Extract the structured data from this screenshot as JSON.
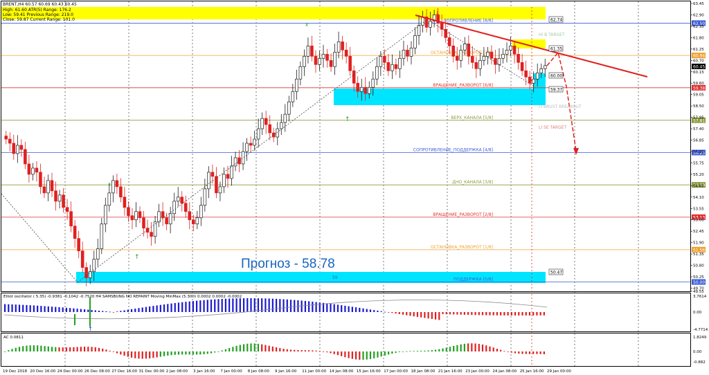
{
  "header": {
    "symbol_line": "BRENT,H4  60.57 60.69 60.43 60.45",
    "stats": [
      "High: 61.60   ATR(5) Range: 176.2",
      "Low:   59.41   Previous Range: 219.0",
      "Close: 59.87   Current Range: 101.0"
    ]
  },
  "forecast_text": "Прогноз - 58.78",
  "murrey_levels": [
    {
      "price": 62.5,
      "label": "СОПРОТИВЛЕНИЕ [8/8]",
      "color": "#3b5bd6",
      "tag": "62.50"
    },
    {
      "price": 60.94,
      "label": "ОСТАНОВКА_РАЗВОРОТ [7/8]",
      "color": "#f0a030",
      "tag": "60.94"
    },
    {
      "price": 59.38,
      "label": "ВРАЩЕНИЕ_РАЗВОРОТ [6/8]",
      "color": "#e03030",
      "tag": "59.38"
    },
    {
      "price": 57.81,
      "label": "ВЕРХ_КАНАЛА [5/8]",
      "color": "#8a9a3a",
      "tag": "57.81"
    },
    {
      "price": 56.25,
      "label": "СОПРОТИВЛЕНИЕ_ПОДДЕРЖКА [4/8]",
      "color": "#3b5bd6",
      "tag": "56.25"
    },
    {
      "price": 54.69,
      "label": "ДНО_КАНАЛА [3/8]",
      "color": "#8a9a3a",
      "tag": "54.69"
    },
    {
      "price": 53.13,
      "label": "ВРАЩЕНИЕ_РАЗВОРОТ [2/8]",
      "color": "#e03030",
      "tag": "53.13"
    },
    {
      "price": 51.56,
      "label": "ОСТАНОВКА_РАЗВОРОТ [1/8]",
      "color": "#f0a030",
      "tag": "51.56"
    },
    {
      "price": 50.0,
      "label": "ПОДДЕРЖКА [0/8]",
      "color": "#3b5bd6",
      "tag": "50.00"
    }
  ],
  "box_tags": [
    "62.74",
    "61.35",
    "60.00",
    "59.37",
    "50.47"
  ],
  "target_labels": [
    "Hi B TARGET",
    "LI BRUST BREAKOUT",
    "LI SE TARGET"
  ],
  "zone_label": "59",
  "price_axis": [
    "63.45",
    "62.90",
    "62.35",
    "61.80",
    "61.25",
    "60.70",
    "60.15",
    "59.60",
    "59.05",
    "58.50",
    "57.95",
    "57.40",
    "56.85",
    "56.30",
    "55.75",
    "55.20",
    "54.65",
    "54.10",
    "53.55",
    "53.00",
    "52.45",
    "51.90",
    "51.35",
    "50.80",
    "50.25",
    "49.70",
    "49.55"
  ],
  "current_price_tag": "60.45",
  "osc1": {
    "title": "Elliot oscillator ( 5.35) -0.9381 -0.1042 -0.7520   H4  SAMSBUNG NO REPAINT   Moving MinMax (5.300) 0.0002 0.0002 -0.0002",
    "axis": [
      "3.7614",
      "0.00",
      "-4.7714"
    ]
  },
  "osc2": {
    "title": "AC 0.0811",
    "axis": [
      "1.8249",
      "0.00",
      "-0.882"
    ]
  },
  "time_axis": [
    "19 Dec 2018",
    "20 Dec 16:00",
    "24 Dec 00:00",
    "26 Dec 08:00",
    "27 Dec 16:00",
    "31 Dec 00:00",
    "2 Jan 08:00",
    "3 Jan 16:00",
    "7 Jan 00:00",
    "8 Jan 08:00",
    "9 Jan 16:00",
    "11 Jan 00:00",
    "14 Jan 08:00",
    "15 Jan 16:00",
    "17 Jan 00:00",
    "18 Jan 08:00",
    "21 Jan 16:00",
    "23 Jan 00:00",
    "24 Jan 08:00",
    "25 Jan 16:00",
    "29 Jan 00:00"
  ],
  "colors": {
    "bull": "#1b1b1b",
    "bear": "#e02020",
    "trend": "#e02020",
    "zone": "#00e5ff",
    "band": "#ffff00",
    "osc_up": "#1a1acc",
    "osc_dn": "#e02020",
    "ac_up": "#20a020"
  },
  "chart_data": {
    "type": "candlestick",
    "symbol": "BRENT",
    "timeframe": "H4",
    "ylim": [
      49.55,
      63.45
    ],
    "x": "4h bars from 19 Dec 2018 to 29 Jan 2019",
    "closes": [
      56.9,
      56.7,
      56.2,
      56.6,
      56.4,
      55.7,
      55.2,
      55.5,
      55.3,
      54.6,
      54.3,
      54.9,
      54.4,
      53.9,
      54.2,
      53.6,
      53.4,
      52.7,
      52.1,
      51.5,
      50.7,
      50.2,
      50.5,
      51.1,
      51.6,
      52.8,
      53.7,
      54.3,
      54.9,
      54.6,
      54.1,
      53.6,
      53.2,
      53.0,
      53.4,
      53.1,
      52.6,
      52.4,
      52.2,
      52.9,
      53.4,
      53.1,
      52.8,
      53.3,
      53.9,
      54.1,
      53.8,
      53.4,
      53.0,
      52.8,
      53.1,
      53.7,
      54.5,
      55.3,
      55.1,
      54.3,
      54.6,
      55.2,
      55.0,
      55.6,
      56.0,
      55.7,
      56.3,
      56.7,
      56.6,
      56.9,
      57.4,
      57.9,
      57.6,
      57.2,
      57.0,
      57.4,
      57.7,
      58.1,
      58.7,
      59.2,
      59.8,
      60.4,
      60.9,
      61.4,
      60.9,
      60.5,
      60.8,
      61.0,
      60.7,
      60.4,
      61.1,
      61.6,
      61.2,
      60.9,
      60.2,
      59.6,
      59.2,
      59.4,
      59.1,
      59.4,
      59.8,
      60.4,
      60.9,
      60.6,
      60.2,
      60.5,
      60.3,
      60.8,
      61.2,
      60.9,
      61.3,
      61.9,
      62.4,
      62.8,
      62.3,
      62.6,
      62.9,
      62.5,
      62.2,
      61.8,
      61.4,
      60.9,
      60.7,
      61.2,
      61.5,
      60.9,
      60.6,
      60.3,
      60.7,
      60.9,
      61.1,
      60.8,
      60.5,
      60.8,
      61.0,
      61.2,
      61.4,
      61.0,
      60.6,
      60.2,
      59.9,
      59.6,
      59.8,
      60.1,
      60.3,
      60.45
    ],
    "forecast": 58.78
  }
}
